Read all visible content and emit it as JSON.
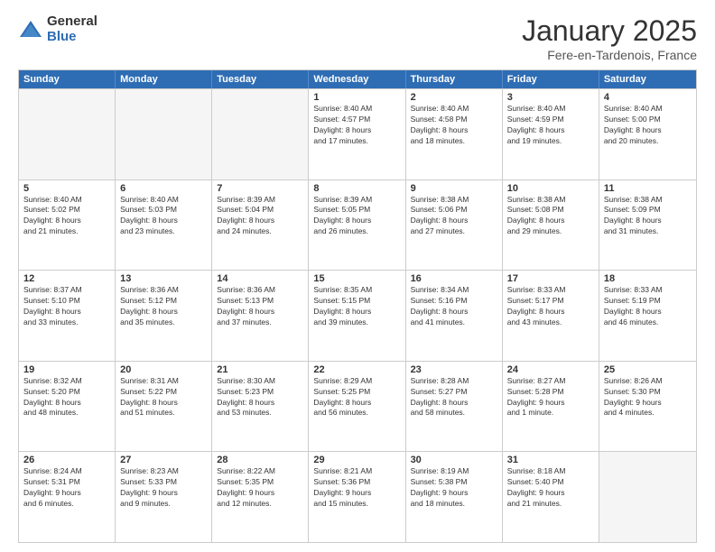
{
  "header": {
    "logo_general": "General",
    "logo_blue": "Blue",
    "title": "January 2025",
    "subtitle": "Fere-en-Tardenois, France"
  },
  "weekdays": [
    "Sunday",
    "Monday",
    "Tuesday",
    "Wednesday",
    "Thursday",
    "Friday",
    "Saturday"
  ],
  "weeks": [
    [
      {
        "day": "",
        "info": ""
      },
      {
        "day": "",
        "info": ""
      },
      {
        "day": "",
        "info": ""
      },
      {
        "day": "1",
        "info": "Sunrise: 8:40 AM\nSunset: 4:57 PM\nDaylight: 8 hours\nand 17 minutes."
      },
      {
        "day": "2",
        "info": "Sunrise: 8:40 AM\nSunset: 4:58 PM\nDaylight: 8 hours\nand 18 minutes."
      },
      {
        "day": "3",
        "info": "Sunrise: 8:40 AM\nSunset: 4:59 PM\nDaylight: 8 hours\nand 19 minutes."
      },
      {
        "day": "4",
        "info": "Sunrise: 8:40 AM\nSunset: 5:00 PM\nDaylight: 8 hours\nand 20 minutes."
      }
    ],
    [
      {
        "day": "5",
        "info": "Sunrise: 8:40 AM\nSunset: 5:02 PM\nDaylight: 8 hours\nand 21 minutes."
      },
      {
        "day": "6",
        "info": "Sunrise: 8:40 AM\nSunset: 5:03 PM\nDaylight: 8 hours\nand 23 minutes."
      },
      {
        "day": "7",
        "info": "Sunrise: 8:39 AM\nSunset: 5:04 PM\nDaylight: 8 hours\nand 24 minutes."
      },
      {
        "day": "8",
        "info": "Sunrise: 8:39 AM\nSunset: 5:05 PM\nDaylight: 8 hours\nand 26 minutes."
      },
      {
        "day": "9",
        "info": "Sunrise: 8:38 AM\nSunset: 5:06 PM\nDaylight: 8 hours\nand 27 minutes."
      },
      {
        "day": "10",
        "info": "Sunrise: 8:38 AM\nSunset: 5:08 PM\nDaylight: 8 hours\nand 29 minutes."
      },
      {
        "day": "11",
        "info": "Sunrise: 8:38 AM\nSunset: 5:09 PM\nDaylight: 8 hours\nand 31 minutes."
      }
    ],
    [
      {
        "day": "12",
        "info": "Sunrise: 8:37 AM\nSunset: 5:10 PM\nDaylight: 8 hours\nand 33 minutes."
      },
      {
        "day": "13",
        "info": "Sunrise: 8:36 AM\nSunset: 5:12 PM\nDaylight: 8 hours\nand 35 minutes."
      },
      {
        "day": "14",
        "info": "Sunrise: 8:36 AM\nSunset: 5:13 PM\nDaylight: 8 hours\nand 37 minutes."
      },
      {
        "day": "15",
        "info": "Sunrise: 8:35 AM\nSunset: 5:15 PM\nDaylight: 8 hours\nand 39 minutes."
      },
      {
        "day": "16",
        "info": "Sunrise: 8:34 AM\nSunset: 5:16 PM\nDaylight: 8 hours\nand 41 minutes."
      },
      {
        "day": "17",
        "info": "Sunrise: 8:33 AM\nSunset: 5:17 PM\nDaylight: 8 hours\nand 43 minutes."
      },
      {
        "day": "18",
        "info": "Sunrise: 8:33 AM\nSunset: 5:19 PM\nDaylight: 8 hours\nand 46 minutes."
      }
    ],
    [
      {
        "day": "19",
        "info": "Sunrise: 8:32 AM\nSunset: 5:20 PM\nDaylight: 8 hours\nand 48 minutes."
      },
      {
        "day": "20",
        "info": "Sunrise: 8:31 AM\nSunset: 5:22 PM\nDaylight: 8 hours\nand 51 minutes."
      },
      {
        "day": "21",
        "info": "Sunrise: 8:30 AM\nSunset: 5:23 PM\nDaylight: 8 hours\nand 53 minutes."
      },
      {
        "day": "22",
        "info": "Sunrise: 8:29 AM\nSunset: 5:25 PM\nDaylight: 8 hours\nand 56 minutes."
      },
      {
        "day": "23",
        "info": "Sunrise: 8:28 AM\nSunset: 5:27 PM\nDaylight: 8 hours\nand 58 minutes."
      },
      {
        "day": "24",
        "info": "Sunrise: 8:27 AM\nSunset: 5:28 PM\nDaylight: 9 hours\nand 1 minute."
      },
      {
        "day": "25",
        "info": "Sunrise: 8:26 AM\nSunset: 5:30 PM\nDaylight: 9 hours\nand 4 minutes."
      }
    ],
    [
      {
        "day": "26",
        "info": "Sunrise: 8:24 AM\nSunset: 5:31 PM\nDaylight: 9 hours\nand 6 minutes."
      },
      {
        "day": "27",
        "info": "Sunrise: 8:23 AM\nSunset: 5:33 PM\nDaylight: 9 hours\nand 9 minutes."
      },
      {
        "day": "28",
        "info": "Sunrise: 8:22 AM\nSunset: 5:35 PM\nDaylight: 9 hours\nand 12 minutes."
      },
      {
        "day": "29",
        "info": "Sunrise: 8:21 AM\nSunset: 5:36 PM\nDaylight: 9 hours\nand 15 minutes."
      },
      {
        "day": "30",
        "info": "Sunrise: 8:19 AM\nSunset: 5:38 PM\nDaylight: 9 hours\nand 18 minutes."
      },
      {
        "day": "31",
        "info": "Sunrise: 8:18 AM\nSunset: 5:40 PM\nDaylight: 9 hours\nand 21 minutes."
      },
      {
        "day": "",
        "info": ""
      }
    ]
  ]
}
